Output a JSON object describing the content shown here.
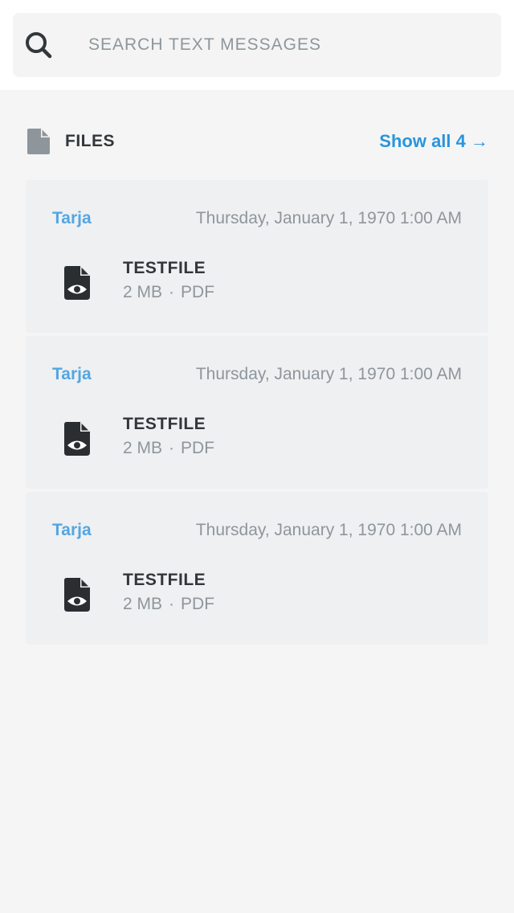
{
  "search": {
    "placeholder": "SEARCH TEXT MESSAGES",
    "value": ""
  },
  "files_section": {
    "title": "FILES",
    "show_all_label": "Show all 4 →"
  },
  "files": [
    {
      "sender": "Tarja",
      "date": "Thursday, January 1, 1970 1:00 AM",
      "name": "TESTFILE",
      "size": "2 MB",
      "separator": "·",
      "type": "PDF"
    },
    {
      "sender": "Tarja",
      "date": "Thursday, January 1, 1970 1:00 AM",
      "name": "TESTFILE",
      "size": "2 MB",
      "separator": "·",
      "type": "PDF"
    },
    {
      "sender": "Tarja",
      "date": "Thursday, January 1, 1970 1:00 AM",
      "name": "TESTFILE",
      "size": "2 MB",
      "separator": "·",
      "type": "PDF"
    }
  ],
  "colors": {
    "accent": "#2a95dc",
    "sender": "#54a6e0",
    "text_dark": "#33373a",
    "text_muted": "#8e969c",
    "card_bg": "#eff0f2"
  },
  "icons": {
    "search": "search-icon",
    "section": "file-icon",
    "file": "document-view-icon"
  }
}
